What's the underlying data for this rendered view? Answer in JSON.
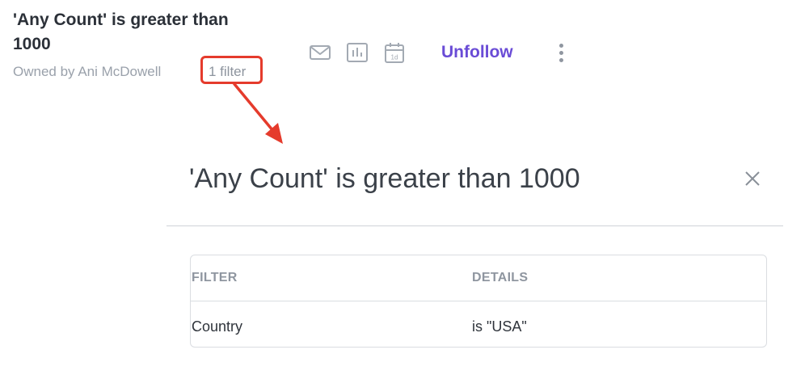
{
  "alert": {
    "title": "'Any Count' is greater than 1000",
    "owner_text": "Owned by Ani McDowell",
    "filter_link": "1 filter"
  },
  "actions": {
    "icons": [
      "mail-icon",
      "chart-icon",
      "calendar-icon"
    ],
    "calendar_badge": "1d",
    "unfollow_label": "Unfollow",
    "more_icon": "kebab-menu-icon"
  },
  "annotation": {
    "color": "#e53b2c"
  },
  "modal": {
    "title": "'Any Count' is greater than 1000",
    "close_icon": "close-icon",
    "table": {
      "headers": [
        "FILTER",
        "DETAILS"
      ],
      "rows": [
        [
          "Country",
          "is \"USA\""
        ]
      ]
    }
  },
  "colors": {
    "accent": "#6a4cd6",
    "annotation": "#e53b2c",
    "muted_text": "#9aa1ab"
  }
}
